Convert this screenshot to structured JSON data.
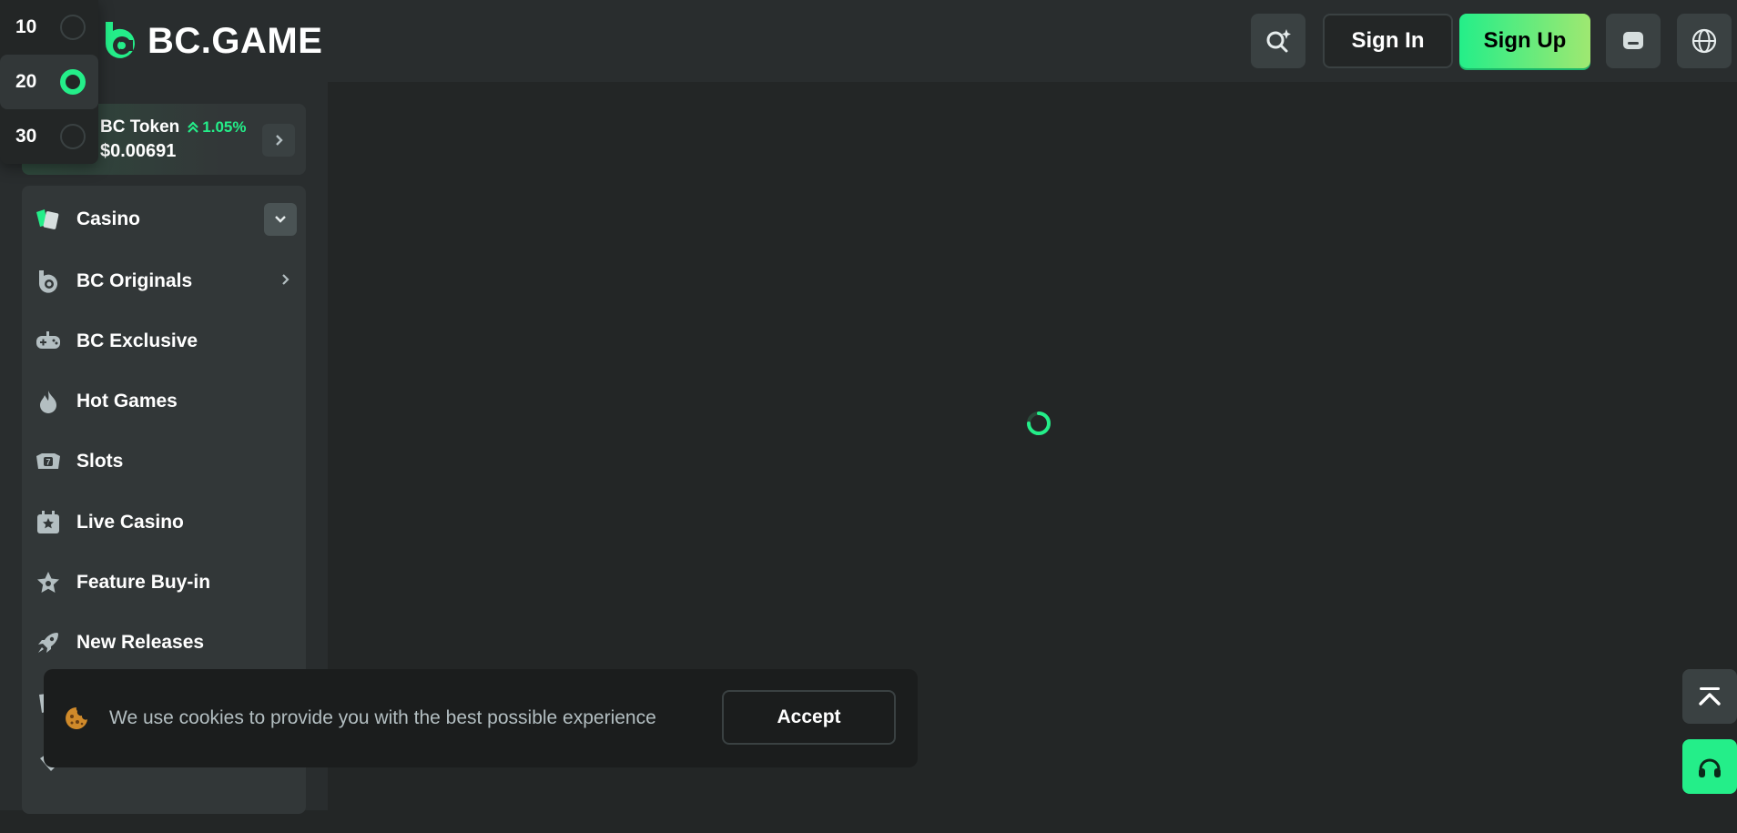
{
  "brand": {
    "name": "BC.GAME",
    "accent": "#24ee89"
  },
  "header": {
    "search_icon": "search-sparkle-icon",
    "signin_label": "Sign In",
    "signup_label": "Sign Up",
    "chat_icon": "chat-icon",
    "language_icon": "globe-icon"
  },
  "token": {
    "name": "BC Token",
    "change": "1.05%",
    "price": "$0.00691"
  },
  "menu": {
    "items": [
      {
        "label": "Casino",
        "icon": "cards-icon"
      },
      {
        "label": "BC Originals",
        "icon": "bc-logo-icon"
      },
      {
        "label": "BC Exclusive",
        "icon": "gamepad-icon"
      },
      {
        "label": "Hot Games",
        "icon": "flame-icon"
      },
      {
        "label": "Slots",
        "icon": "slot-machine-icon"
      },
      {
        "label": "Live Casino",
        "icon": "live-casino-icon"
      },
      {
        "label": "Feature Buy-in",
        "icon": "star-badge-icon"
      },
      {
        "label": "New Releases",
        "icon": "rocket-icon"
      }
    ]
  },
  "page_size": {
    "options": [
      "10",
      "20",
      "30"
    ],
    "selected": "20"
  },
  "cookie": {
    "text": "We use cookies to provide you with the best possible experience",
    "accept_label": "Accept"
  }
}
